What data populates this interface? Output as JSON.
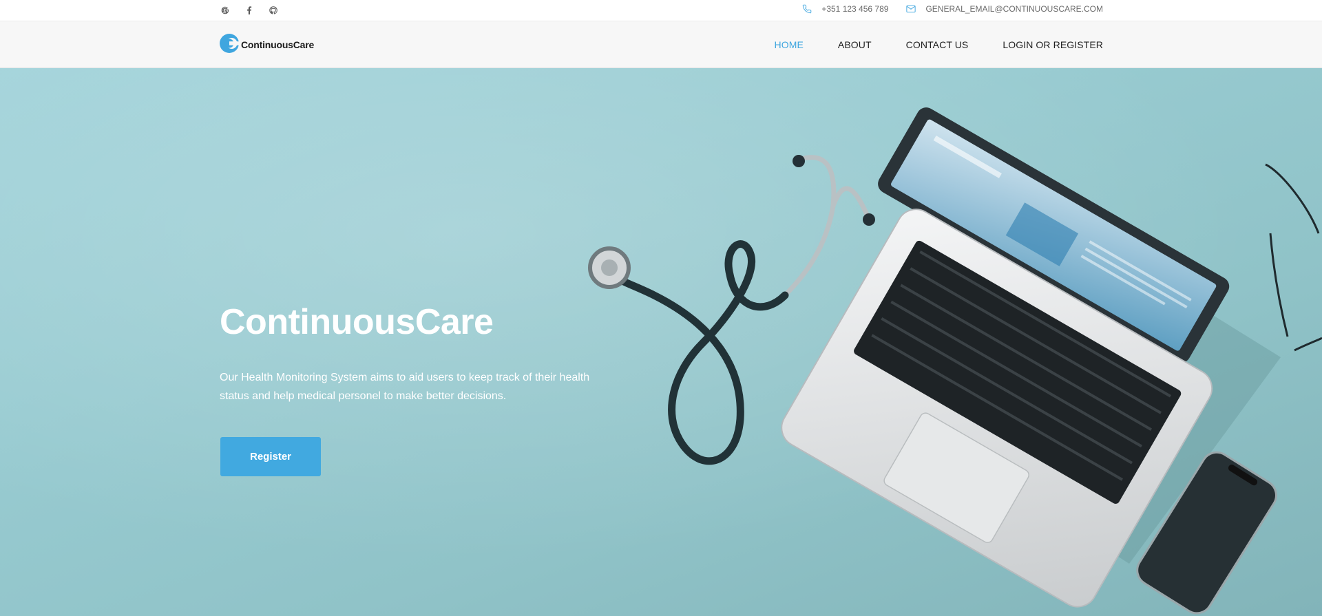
{
  "topbar": {
    "social": [
      {
        "icon": "google-icon"
      },
      {
        "icon": "facebook-icon"
      },
      {
        "icon": "github-icon"
      }
    ],
    "phone": "+351 123 456 789",
    "email": "GENERAL_EMAIL@CONTINUOUSCARE.COM"
  },
  "navbar": {
    "brand": "ContinuousCare",
    "links": [
      {
        "label": "HOME",
        "active": true
      },
      {
        "label": "ABOUT",
        "active": false
      },
      {
        "label": "CONTACT US",
        "active": false
      },
      {
        "label": "LOGIN OR REGISTER",
        "active": false
      }
    ]
  },
  "hero": {
    "title": "ContinuousCare",
    "description": "Our Health Monitoring System aims to aid users to keep track of their health status and help medical personel to make better decisions.",
    "button_label": "Register"
  },
  "colors": {
    "accent": "#41a9e0",
    "active_link": "#3fa6df",
    "hero_background": "#9bcfd5"
  }
}
